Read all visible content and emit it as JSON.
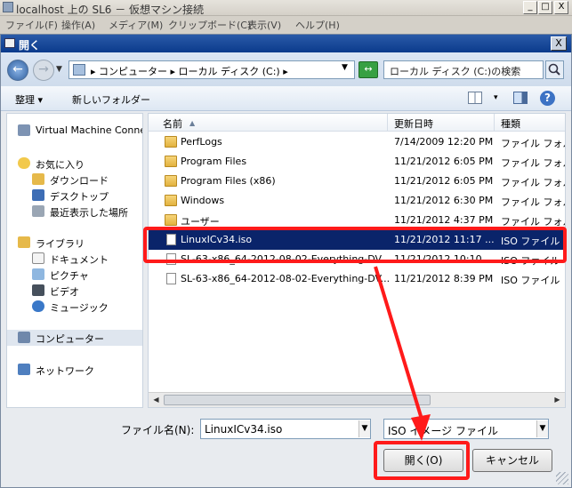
{
  "vm_window": {
    "title": "localhost 上の SL6 － 仮想マシン接続",
    "menus": [
      "ファイル(F)",
      "操作(A)",
      "メディア(M)",
      "クリップボード(C)",
      "表示(V)",
      "ヘルプ(H)"
    ],
    "controls": [
      "_",
      "□",
      "X"
    ]
  },
  "dialog": {
    "title": "開く",
    "close_label": "X",
    "address": {
      "path": "▸ コンピューター ▸ ローカル ディスク (C:) ▸",
      "back": "←",
      "forward": "→",
      "refresh": "↔"
    },
    "search": {
      "placeholder": "ローカル ディスク (C:)の検索"
    },
    "toolbar": {
      "organize": "整理 ▾",
      "new_folder": "新しいフォルダー",
      "views_dd": "▾",
      "help": "?"
    },
    "nav": {
      "items": [
        {
          "label": "Virtual Machine Conne",
          "icon": "network-drive-icon"
        },
        {
          "label": "お気に入り",
          "icon": "star-icon"
        },
        {
          "label": "ダウンロード",
          "icon": "download-folder-icon"
        },
        {
          "label": "デスクトップ",
          "icon": "desktop-icon"
        },
        {
          "label": "最近表示した場所",
          "icon": "recent-places-icon"
        },
        {
          "label": "ライブラリ",
          "icon": "library-icon"
        },
        {
          "label": "ドキュメント",
          "icon": "documents-icon"
        },
        {
          "label": "ピクチャ",
          "icon": "pictures-icon"
        },
        {
          "label": "ビデオ",
          "icon": "video-icon"
        },
        {
          "label": "ミュージック",
          "icon": "music-icon"
        },
        {
          "label": "コンピューター",
          "icon": "computer-icon"
        },
        {
          "label": "ネットワーク",
          "icon": "network-icon"
        }
      ]
    },
    "columns": {
      "name": "名前",
      "sort_indicator": "▲",
      "date": "更新日時",
      "type": "種類"
    },
    "files": [
      {
        "name": "PerfLogs",
        "date": "7/14/2009 12:20 PM",
        "type": "ファイル フォルダー",
        "kind": "folder"
      },
      {
        "name": "Program Files",
        "date": "11/21/2012 6:05 PM",
        "type": "ファイル フォルダー",
        "kind": "folder"
      },
      {
        "name": "Program Files (x86)",
        "date": "11/21/2012 6:05 PM",
        "type": "ファイル フォルダー",
        "kind": "folder"
      },
      {
        "name": "Windows",
        "date": "11/21/2012 6:30 PM",
        "type": "ファイル フォルダー",
        "kind": "folder"
      },
      {
        "name": "ユーザー",
        "date": "11/21/2012 4:37 PM",
        "type": "ファイル フォルダー",
        "kind": "folder"
      },
      {
        "name": "LinuxICv34.iso",
        "date": "11/21/2012 11:17 ...",
        "type": "ISO ファイル",
        "kind": "file",
        "selected": true
      },
      {
        "name": "SL-63-x86_64-2012-08-02-Everything-DV...",
        "date": "11/21/2012 10:10 ...",
        "type": "ISO ファイル",
        "kind": "file"
      },
      {
        "name": "SL-63-x86_64-2012-08-02-Everything-DV...",
        "date": "11/21/2012 8:39 PM",
        "type": "ISO ファイル",
        "kind": "file"
      }
    ],
    "filename_label": "ファイル名(N):",
    "filename_value": "LinuxICv34.iso",
    "filetype_value": "ISO イメージ ファイル",
    "dropdown_glyph": "▼",
    "open_button": "開く(O)",
    "cancel_button": "キャンセル",
    "scroll": {
      "left": "◀",
      "right": "▶"
    }
  },
  "colors": {
    "annotation": "#ff1a1a",
    "selection": "#0a246a",
    "dialog_title": "#0b3b8c"
  }
}
